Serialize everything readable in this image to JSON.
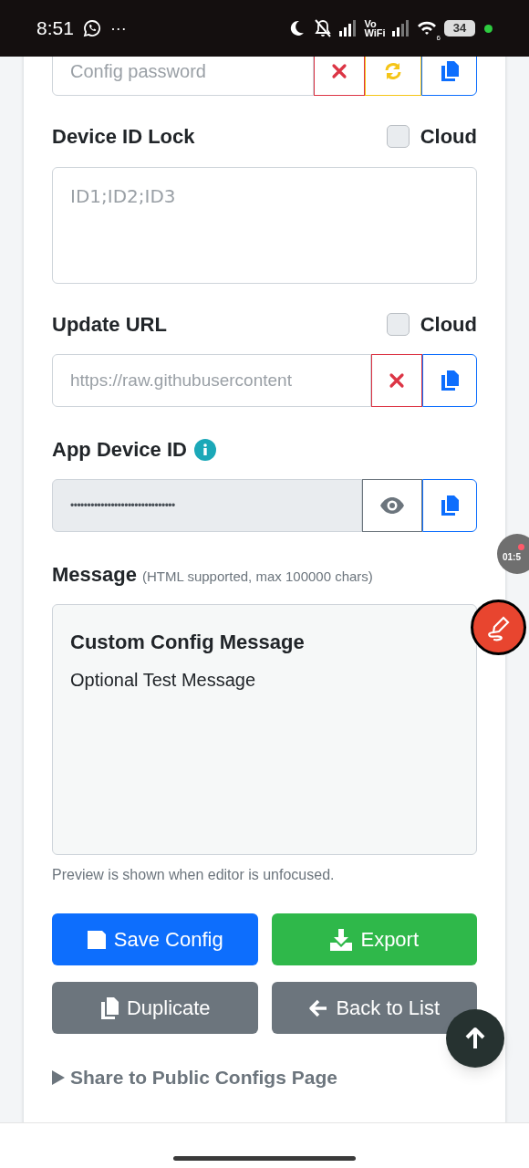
{
  "status_bar": {
    "time": "8:51",
    "more": "···",
    "vowifi_top": "Vo",
    "vowifi_bottom": "WiFi",
    "wifi_badge": "6",
    "battery": "34"
  },
  "password_field": {
    "placeholder": "Config password"
  },
  "device_id_lock": {
    "label": "Device ID Lock",
    "cloud": {
      "label": "Cloud",
      "checked": false
    },
    "placeholder": "ID1;ID2;ID3"
  },
  "update_url": {
    "label": "Update URL",
    "cloud": {
      "label": "Cloud",
      "checked": false
    },
    "placeholder": "https://raw.githubusercontent"
  },
  "app_device_id": {
    "label": "App Device ID",
    "value": "•••••••••••••••••••••••••••••••"
  },
  "message": {
    "label": "Message",
    "hint": "(HTML supported, max 100000 chars)",
    "preview_title": "Custom Config Message",
    "preview_text": "Optional Test Message",
    "note": "Preview is shown when editor is unfocused."
  },
  "buttons": [
    {
      "label": "Save Config",
      "kind": "save"
    },
    {
      "label": "Export",
      "kind": "export"
    },
    {
      "label": "Duplicate",
      "kind": "duplicate"
    },
    {
      "label": "Back to List",
      "kind": "back"
    }
  ],
  "share": {
    "label": "Share to Public Configs Page",
    "expanded": false
  },
  "recorder": {
    "time": "01:5"
  }
}
